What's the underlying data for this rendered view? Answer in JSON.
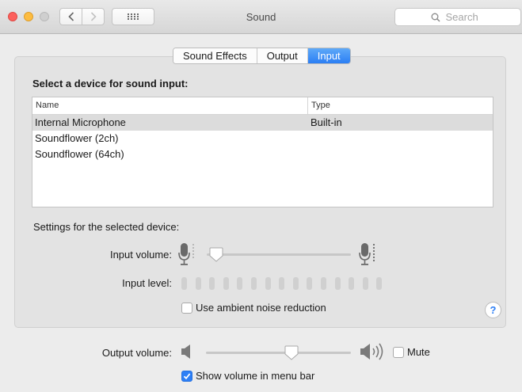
{
  "window": {
    "title": "Sound",
    "search_placeholder": "Search"
  },
  "tabs": [
    {
      "label": "Sound Effects",
      "selected": false
    },
    {
      "label": "Output",
      "selected": false
    },
    {
      "label": "Input",
      "selected": true
    }
  ],
  "input": {
    "heading": "Select a device for sound input:",
    "columns": {
      "name": "Name",
      "type": "Type"
    },
    "devices": [
      {
        "name": "Internal Microphone",
        "type": "Built-in",
        "selected": true
      },
      {
        "name": "Soundflower (2ch)",
        "type": "",
        "selected": false
      },
      {
        "name": "Soundflower (64ch)",
        "type": "",
        "selected": false
      }
    ],
    "settings_label": "Settings for the selected device:",
    "input_volume_label": "Input volume:",
    "input_volume": 0.03,
    "input_level_label": "Input level:",
    "input_level_segments": 15,
    "input_level_active": 0,
    "ambient_noise": {
      "label": "Use ambient noise reduction",
      "checked": false
    },
    "help": "?"
  },
  "output": {
    "volume_label": "Output volume:",
    "volume": 0.6,
    "mute": {
      "label": "Mute",
      "checked": false
    },
    "show_in_menu_bar": {
      "label": "Show volume in menu bar",
      "checked": true
    }
  },
  "colors": {
    "accent": "#2d7ff6",
    "close": "#fc605c",
    "minimize": "#fdbc40",
    "zoom": "#cfcfcf"
  },
  "icons": {
    "back": "chevron-left-icon",
    "forward": "chevron-right-icon",
    "grid": "grid-icon",
    "search": "magnifier-icon",
    "mic_low": "microphone-icon",
    "mic_high": "microphone-icon",
    "speaker_low": "speaker-icon",
    "speaker_high": "speaker-waves-icon"
  }
}
